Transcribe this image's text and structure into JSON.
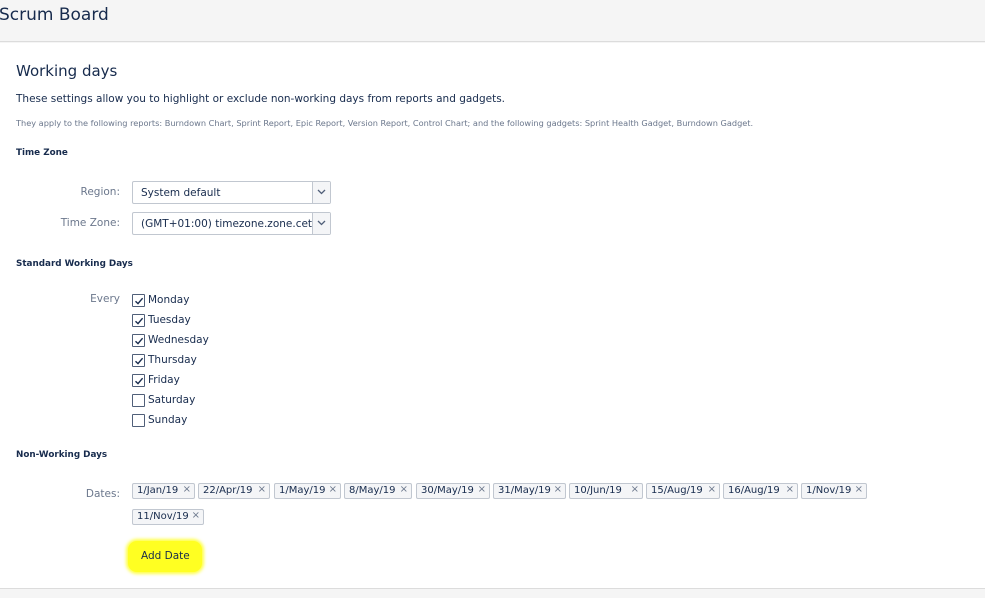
{
  "header": {
    "title": "Scrum Board"
  },
  "page": {
    "heading": "Working days",
    "description": "These settings allow you to highlight or exclude non-working days from reports and gadgets.",
    "subdescription": "They apply to the following reports: Burndown Chart, Sprint Report, Epic Report, Version Report, Control Chart; and the following gadgets: Sprint Health Gadget, Burndown Gadget."
  },
  "timezone": {
    "section_title": "Time Zone",
    "region_label": "Region:",
    "region_value": "System default",
    "tz_label": "Time Zone:",
    "tz_value": "(GMT+01:00) timezone.zone.cet"
  },
  "working_days": {
    "section_title": "Standard Working Days",
    "every_label": "Every",
    "days": [
      {
        "label": "Monday",
        "checked": true
      },
      {
        "label": "Tuesday",
        "checked": true
      },
      {
        "label": "Wednesday",
        "checked": true
      },
      {
        "label": "Thursday",
        "checked": true
      },
      {
        "label": "Friday",
        "checked": true
      },
      {
        "label": "Saturday",
        "checked": false
      },
      {
        "label": "Sunday",
        "checked": false
      }
    ]
  },
  "non_working": {
    "section_title": "Non-Working Days",
    "dates_label": "Dates:",
    "dates": [
      "1/Jan/19",
      "22/Apr/19",
      "1/May/19",
      "8/May/19",
      "30/May/19",
      "31/May/19",
      "10/Jun/19",
      "15/Aug/19",
      "16/Aug/19",
      "1/Nov/19",
      "11/Nov/19"
    ],
    "remove_glyph": "×",
    "add_button": "Add Date"
  },
  "colors": {
    "highlight": "#ffff22",
    "text": "#172b4d",
    "muted": "#6b778c"
  }
}
